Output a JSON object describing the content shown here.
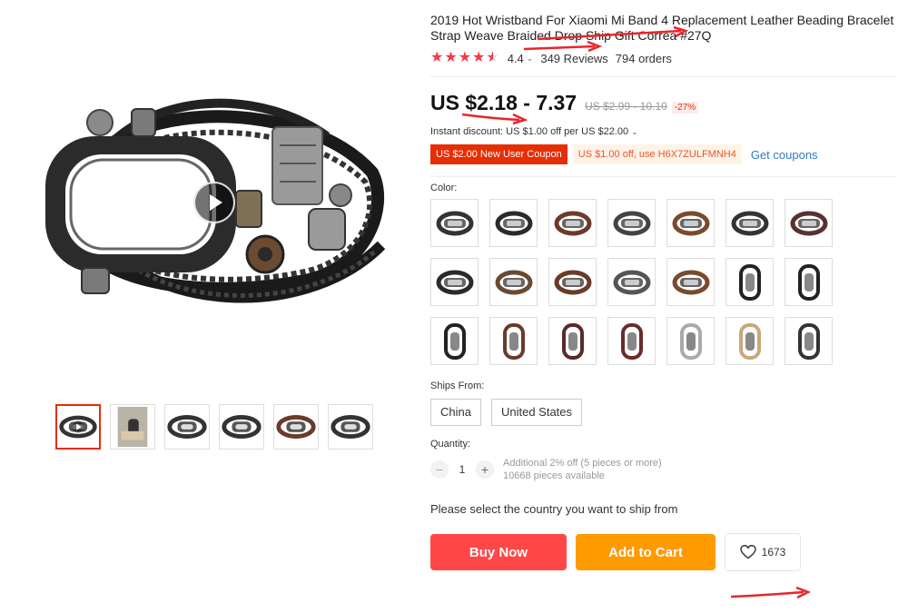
{
  "product": {
    "title": "2019 Hot Wristband For Xiaomi Mi Band 4 Replacement Leather Beading Bracelet Strap Weave Braided Drop Ship Gift Correa #27Q",
    "rating": "4.4",
    "rating_stars": 4.5,
    "reviews": "349 Reviews",
    "orders": "794 orders"
  },
  "pricing": {
    "price": "US $2.18 - 7.37",
    "original_price": "US $2.99 - 10.10",
    "discount": "-27%",
    "instant_discount": "Instant discount: US $1.00 off per US $22.00",
    "coupon_new_user": "US $2.00 New User Coupon",
    "coupon_code": "US $1.00 off, use H6X7ZULFMNH4",
    "get_coupons": "Get coupons"
  },
  "color": {
    "label": "Color:",
    "swatch_count": 21
  },
  "shipping": {
    "label": "Ships From:",
    "options": [
      "China",
      "United States"
    ],
    "message": "Please select the country you want to ship from"
  },
  "quantity": {
    "label": "Quantity:",
    "value": "1",
    "minus": "−",
    "plus": "+",
    "note_line1": "Additional 2% off (5 pieces or more)",
    "note_line2": "10668 pieces available"
  },
  "actions": {
    "buy_now": "Buy Now",
    "add_to_cart": "Add to Cart",
    "wishlist_count": "1673"
  },
  "colors": {
    "accent_red": "#ff4747",
    "accent_orange": "#ff9a00",
    "star": "#f23b4b",
    "link": "#2e7bc4"
  }
}
